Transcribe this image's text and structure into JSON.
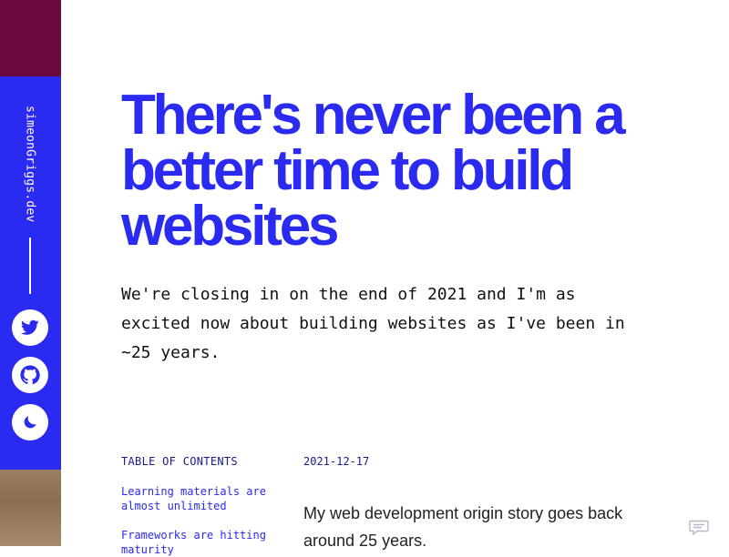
{
  "sidebar": {
    "site_name": "simeonGriggs.dev",
    "icons": {
      "twitter": "twitter-icon",
      "github": "github-icon",
      "theme": "moon-icon"
    },
    "colors": {
      "top": "#6a0a3c",
      "main": "#2a2af0",
      "bottom": "#9a8063"
    }
  },
  "article": {
    "title": "There's never been a better time to build websites",
    "intro": "We're closing in on the end of 2021 and I'm as excited now about building websites as I've been in ~25 years.",
    "date": "2021-12-17",
    "body_start": "My web development origin story goes back around 25 years."
  },
  "toc": {
    "title": "TABLE OF CONTENTS",
    "items": [
      "Learning materials are almost unlimited",
      "Frameworks are hitting maturity"
    ]
  },
  "chat": {
    "icon": "chat-icon"
  },
  "theme": {
    "accent": "#2a2af0",
    "text": "#111111"
  }
}
